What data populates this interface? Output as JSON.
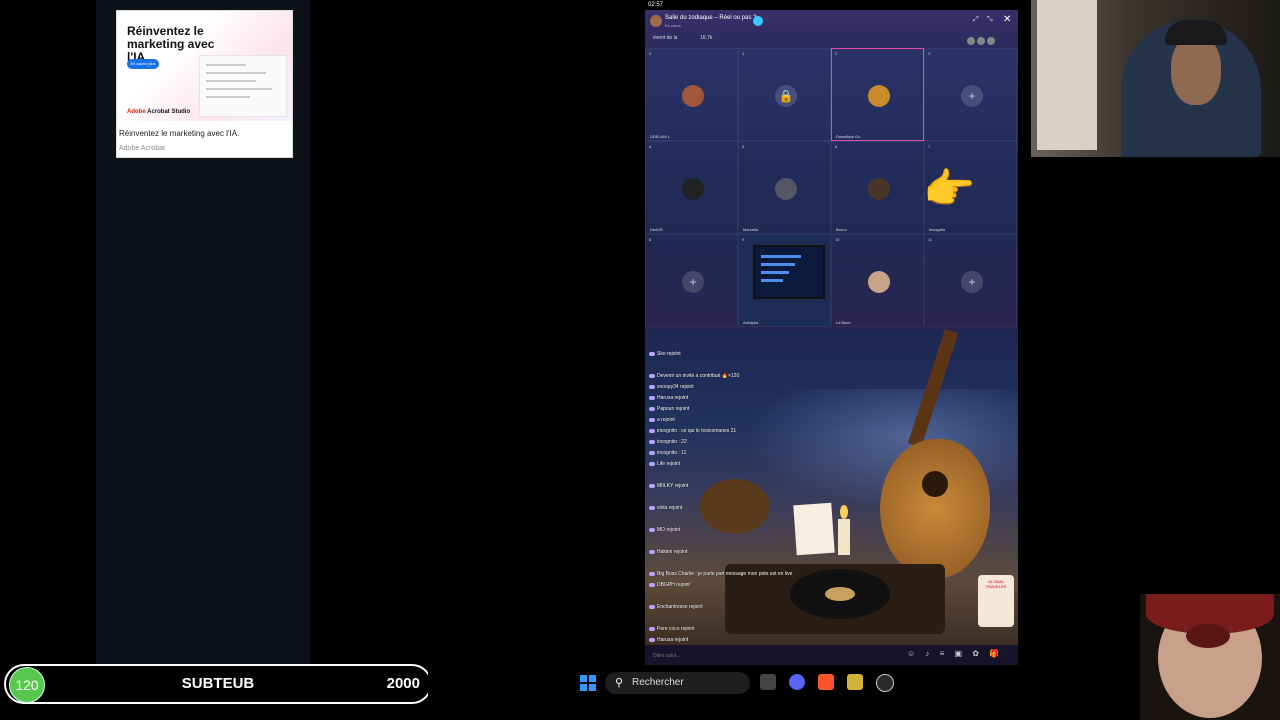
{
  "ad": {
    "headline": "Réinventez le marketing avec l'IA.",
    "cta": "En savoir plus",
    "brand_red": "Adobe",
    "brand_rest": " Acrobat Studio",
    "title": "Réinventez le marketing avec l'IA.",
    "sponsor": "Adobe Acrobat"
  },
  "phone": {
    "status_time": "02:57",
    "room_title": "Salle du zodiaque – Réel ou pas ?",
    "room_sub": "En cours",
    "host_label": "évent de la",
    "viewer_count": "16.7k",
    "seats": [
      {
        "num": "0",
        "name": "UDELAM  L",
        "type": "user",
        "color": "#a0583a"
      },
      {
        "num": "1",
        "name": "",
        "type": "locked"
      },
      {
        "num": "2",
        "name": "Dreadlock Gu",
        "type": "user-active",
        "color": "#c98a2c"
      },
      {
        "num": "3",
        "name": "",
        "type": "empty"
      },
      {
        "num": "4",
        "name": "DeaVS",
        "type": "user",
        "color": "#222"
      },
      {
        "num": "5",
        "name": "Marcello",
        "type": "user",
        "color": "#556"
      },
      {
        "num": "6",
        "name": "Bruno",
        "type": "user",
        "color": "#4a3626"
      },
      {
        "num": "7",
        "name": "Incognito",
        "type": "hand"
      },
      {
        "num": "8",
        "name": "",
        "type": "empty"
      },
      {
        "num": "9",
        "name": "ArtAlpha",
        "type": "screen"
      },
      {
        "num": "10",
        "name": "La Bach",
        "type": "user",
        "color": "#c9a28a"
      },
      {
        "num": "11",
        "name": "",
        "type": "empty"
      }
    ],
    "chat": [
      {
        "text": "Sko  rejoint"
      },
      {
        "text": ""
      },
      {
        "text": "Devenir un invité a contribué  🔥×120"
      },
      {
        "text": "snoopy34  rejoint"
      },
      {
        "text": "Harusa  rejoint"
      },
      {
        "text": "Papoun  rejoint"
      },
      {
        "text": "a rejoint"
      },
      {
        "text": "incognito  : ce qui le toxicomanes 21"
      },
      {
        "text": "incognito  : 22"
      },
      {
        "text": "incognito  : 11"
      },
      {
        "text": "Life  rejoint"
      },
      {
        "text": ""
      },
      {
        "text": "MIILKY  rejoint"
      },
      {
        "text": ""
      },
      {
        "text": "viola  rejoint"
      },
      {
        "text": ""
      },
      {
        "text": "MO  rejoint"
      },
      {
        "text": ""
      },
      {
        "text": "Hakimi  rejoint"
      },
      {
        "text": ""
      },
      {
        "text": "Big Boss Charlie : je parle part message mon pote est en live"
      },
      {
        "text": "DBGPH  rejoint"
      },
      {
        "text": ""
      },
      {
        "text": "Enchantresse  rejoint"
      },
      {
        "text": ""
      },
      {
        "text": "Pere coco  rejoint"
      },
      {
        "text": "Harusa  rejoint"
      }
    ],
    "gift_text": "GLOBAL TRAVELER",
    "input_placeholder": "Dites salut..."
  },
  "goal": {
    "current": "120",
    "label": "SUBTEUB",
    "target": "2000"
  },
  "taskbar": {
    "search_label": "Rechercher"
  },
  "colors": {
    "goal_green": "#57c84b",
    "windows_blue": "#2f9bff",
    "active_seat": "#e14ca4"
  }
}
